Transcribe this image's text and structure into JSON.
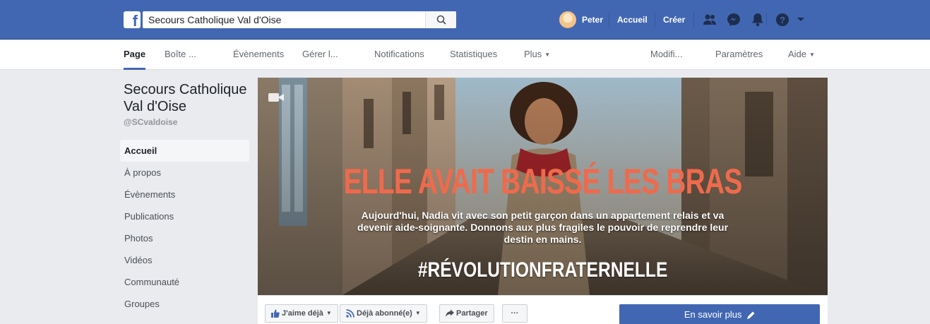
{
  "topbar": {
    "logo": "f",
    "search_value": "Secours Catholique Val d'Oise",
    "user_name": "Peter",
    "home_label": "Accueil",
    "create_label": "Créer"
  },
  "tabs": [
    {
      "label": "Page"
    },
    {
      "label": "Boîte ..."
    },
    {
      "label": "Évènements"
    },
    {
      "label": "Gérer l..."
    },
    {
      "label": "Notifications"
    },
    {
      "label": "Statistiques"
    },
    {
      "label": "Plus"
    },
    {
      "label": "Modifi..."
    },
    {
      "label": "Paramètres"
    },
    {
      "label": "Aide"
    }
  ],
  "page": {
    "name": "Secours Catholique Val d'Oise",
    "handle": "@SCvaldoise"
  },
  "sidebar": {
    "items": [
      {
        "label": "Accueil"
      },
      {
        "label": "À propos"
      },
      {
        "label": "Évènements"
      },
      {
        "label": "Publications"
      },
      {
        "label": "Photos"
      },
      {
        "label": "Vidéos"
      },
      {
        "label": "Communauté"
      },
      {
        "label": "Groupes"
      }
    ]
  },
  "cover": {
    "headline": "ELLE AVAIT BAISSÉ LES BRAS",
    "subtext": "Aujourd'hui, Nadia vit avec son petit garçon dans un appartement relais et va devenir aide-soignante. Donnons aux plus fragiles le pouvoir de reprendre leur destin en mains.",
    "hashtag": "#RÉVOLUTIONFRATERNELLE"
  },
  "actions": {
    "like": "J'aime déjà",
    "follow": "Déjà abonné(e)",
    "share": "Partager",
    "more": "···",
    "cta": "En savoir plus"
  },
  "colors": {
    "brand_blue": "#4267b2",
    "headline_orange": "#ef6a4c"
  }
}
